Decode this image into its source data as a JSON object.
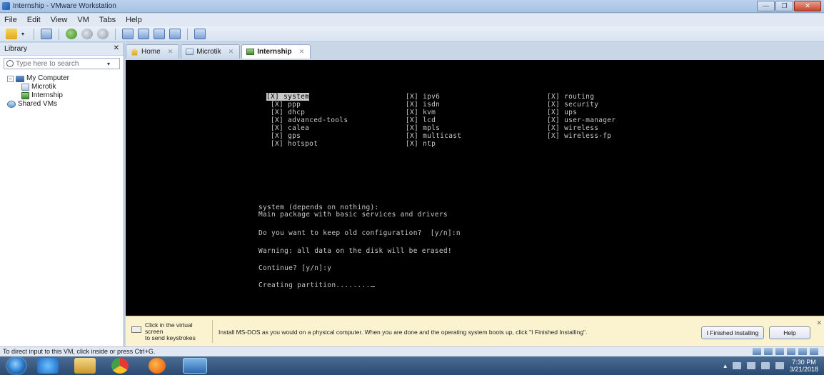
{
  "window": {
    "title": "Internship - VMware Workstation"
  },
  "menu": [
    "File",
    "Edit",
    "View",
    "VM",
    "Tabs",
    "Help"
  ],
  "library": {
    "header": "Library",
    "search_placeholder": "Type here to search",
    "tree": {
      "root": "My Computer",
      "vms": [
        "Microtik",
        "Internship"
      ],
      "shared": "Shared VMs"
    }
  },
  "tabs": [
    {
      "label": "Home",
      "active": false
    },
    {
      "label": "Microtik",
      "active": false
    },
    {
      "label": "Internship",
      "active": true
    }
  ],
  "console": {
    "packages_col1": [
      "[X] system",
      "[X] ppp",
      "[X] dhcp",
      "[X] advanced-tools",
      "[X] calea",
      "[X] gps",
      "[X] hotspot"
    ],
    "packages_col2": [
      "[X] ipv6",
      "[X] isdn",
      "[X] kvm",
      "[X] lcd",
      "[X] mpls",
      "[X] multicast",
      "[X] ntp"
    ],
    "packages_col3": [
      "[X] routing",
      "[X] security",
      "[X] ups",
      "[X] user-manager",
      "[X] wireless",
      "[X] wireless-fp"
    ],
    "desc_line1": "system (depends on nothing):",
    "desc_line2": "Main package with basic services and drivers",
    "prompt_keep": "Do you want to keep old configuration?  [y/n]:n",
    "warning": "Warning: all data on the disk will be erased!",
    "prompt_continue": "Continue? [y/n]:y",
    "progress": "Creating partition........"
  },
  "infobar": {
    "click_hint_line1": "Click in the virtual screen",
    "click_hint_line2": "to send keystrokes",
    "message": "Install MS-DOS as you would on a physical computer. When you are done and the operating system boots up, click \"I Finished Installing\".",
    "finished_button": "I Finished Installing",
    "help_button": "Help"
  },
  "statusbar": {
    "text": "To direct input to this VM, click inside or press Ctrl+G."
  },
  "taskbar": {
    "time": "7:30 PM",
    "date": "3/21/2018"
  }
}
